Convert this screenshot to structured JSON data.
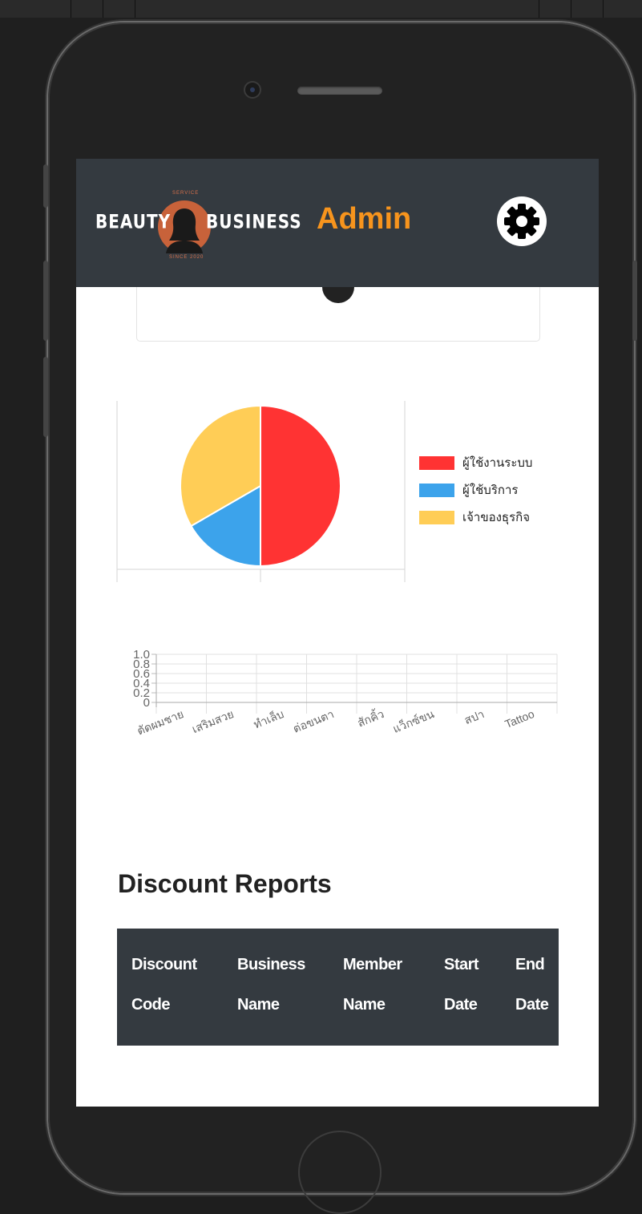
{
  "header": {
    "logo": {
      "word_left": "BEAUTY",
      "word_right": "BUSINESS",
      "top_text": "SERVICE",
      "bottom_text": "SINCE 2020"
    },
    "title": "Admin",
    "settings_icon": "gear-icon"
  },
  "colors": {
    "header_bg": "#343a40",
    "admin_text": "#f7941d",
    "red": "#ff3333",
    "blue": "#3ca3eb",
    "yellow": "#ffcd56"
  },
  "chart_data": [
    {
      "type": "pie",
      "series": [
        {
          "name": "ผู้ใช้งานระบบ",
          "value": 3,
          "color": "#ff3333"
        },
        {
          "name": "ผู้ใช้บริการ",
          "value": 1,
          "color": "#3ca3eb"
        },
        {
          "name": "เจ้าของธุรกิจ",
          "value": 2,
          "color": "#ffcd56"
        }
      ],
      "legend": "right"
    },
    {
      "type": "bar",
      "categories": [
        "ตัดผมชาย",
        "เสริมสวย",
        "ทำเล็บ",
        "ต่อขนตา",
        "สักคิ้ว",
        "แว็กซ์ขน",
        "สปา",
        "Tattoo"
      ],
      "values": [
        0,
        0,
        0,
        0,
        0,
        0,
        0,
        0
      ],
      "yticks": [
        "0",
        "0.2",
        "0.4",
        "0.6",
        "0.8",
        "1.0"
      ],
      "ylim": [
        0,
        1
      ],
      "grid": true
    }
  ],
  "reports": {
    "title": "Discount Reports",
    "columns": [
      {
        "line1": "Discount",
        "line2": "Code"
      },
      {
        "line1": "Business",
        "line2": "Name"
      },
      {
        "line1": "Member",
        "line2": "Name"
      },
      {
        "line1": "Start",
        "line2": "Date"
      },
      {
        "line1": "End",
        "line2": "Date"
      }
    ]
  }
}
